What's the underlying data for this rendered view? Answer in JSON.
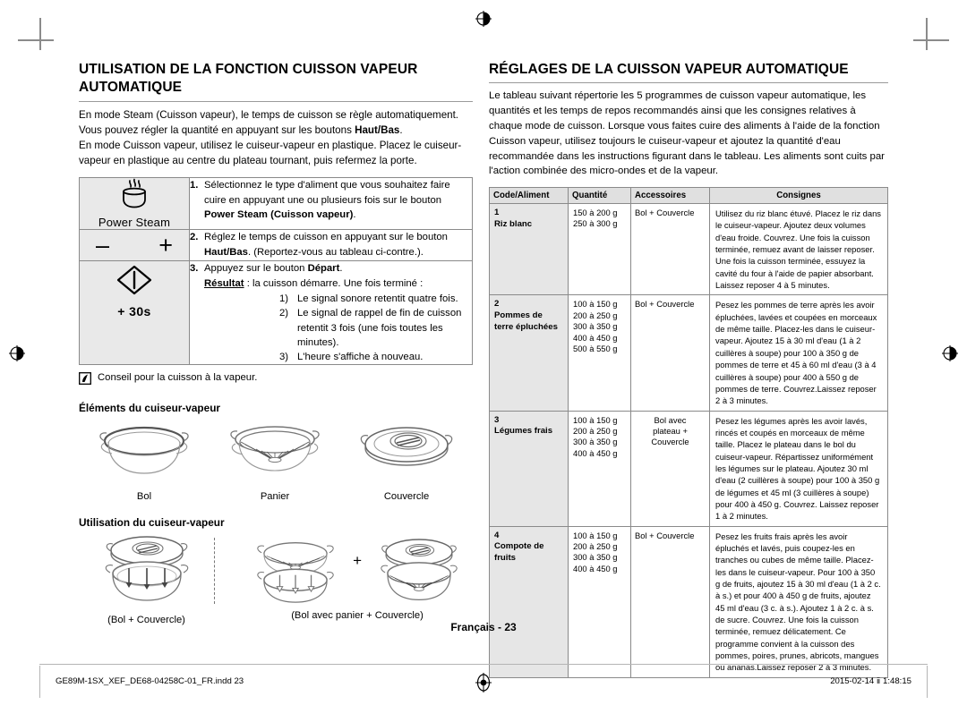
{
  "left": {
    "title": "UTILISATION DE LA FONCTION CUISSON VAPEUR AUTOMATIQUE",
    "intro_1": "En mode Steam (Cuisson vapeur), le temps de cuisson se règle automatiquement.",
    "intro_2a": "Vous pouvez régler la quantité en appuyant sur les boutons ",
    "intro_2b": "Haut/Bas",
    "intro_2c": ".",
    "intro_3": "En mode Cuisson vapeur, utilisez le cuiseur-vapeur en plastique. Placez le cuiseur-vapeur en plastique au centre du plateau tournant, puis refermez la porte.",
    "steps": [
      {
        "num": "1.",
        "icon_name": "power-steam-icon",
        "icon_label": "Power Steam",
        "text_before": "Sélectionnez le type d'aliment que vous souhaitez faire cuire en appuyant une ou plusieurs fois sur le bouton ",
        "text_bold": "Power Steam (Cuisson vapeur)",
        "text_after": "."
      },
      {
        "num": "2.",
        "icon_name": "minus-plus-icon",
        "icon_minus": "–",
        "icon_plus": "+",
        "text_before": "Réglez le temps de cuisson en appuyant sur le bouton ",
        "text_bold": "Haut/Bas",
        "text_after": ". (Reportez-vous au tableau ci-contre.)."
      },
      {
        "num": "3.",
        "icon_name": "start-plus-30s-icon",
        "icon_label": "+ 30s",
        "line1_before": "Appuyez sur le bouton ",
        "line1_bold": "Départ",
        "line1_after": ".",
        "result_label": "Résultat",
        "result_text": " :  la cuisson démarre. Une fois terminé :",
        "sub": [
          {
            "n": "1)",
            "t": "Le signal sonore retentit quatre fois."
          },
          {
            "n": "2)",
            "t": "Le signal de rappel de fin de cuisson retentit 3 fois (une fois toutes les minutes)."
          },
          {
            "n": "3)",
            "t": "L'heure s'affiche à nouveau."
          }
        ]
      }
    ],
    "note": "Conseil pour la cuisson à la vapeur.",
    "subhead_elements": "Éléments du cuiseur-vapeur",
    "elements": [
      {
        "name": "bowl-illustration",
        "caption": "Bol"
      },
      {
        "name": "basket-illustration",
        "caption": "Panier"
      },
      {
        "name": "lid-illustration",
        "caption": "Couvercle"
      }
    ],
    "subhead_usage": "Utilisation du cuiseur-vapeur",
    "usage": [
      {
        "name": "bowl-plus-lid-illustration",
        "caption": "(Bol + Couvercle)"
      },
      {
        "name": "bowl-with-basket-plus-lid-illustration",
        "caption": "(Bol avec panier + Couvercle)"
      }
    ],
    "plus_separator": "+"
  },
  "right": {
    "title": "RÉGLAGES DE LA CUISSON VAPEUR AUTOMATIQUE",
    "intro": "Le tableau suivant répertorie les 5 programmes de cuisson vapeur automatique, les quantités et les temps de repos recommandés ainsi que les consignes relatives à chaque mode de cuisson. Lorsque vous faites cuire des aliments à l'aide de la fonction Cuisson vapeur, utilisez toujours le cuiseur-vapeur et ajoutez la quantité d'eau recommandée dans les instructions figurant dans le tableau. Les aliments sont cuits par l'action combinée des micro-ondes et de la vapeur.",
    "table": {
      "headers": [
        "Code/Aliment",
        "Quantité",
        "Accessoires",
        "Consignes"
      ],
      "rows": [
        {
          "code": "1",
          "food": "Riz blanc",
          "quantities": [
            "150 à 200 g",
            "250 à 300 g"
          ],
          "accessories": [
            "Bol + Couvercle"
          ],
          "accessories_center": false,
          "instructions": "Utilisez du riz blanc étuvé. Placez le riz dans le cuiseur-vapeur. Ajoutez deux volumes d'eau froide. Couvrez. Une fois la cuisson terminée, remuez avant de laisser reposer. Une fois la cuisson terminée, essuyez la cavité du four à l'aide de papier absorbant. Laissez reposer 4 à 5 minutes."
        },
        {
          "code": "2",
          "food": "Pommes de terre épluchées",
          "quantities": [
            "100 à 150 g",
            "200 à 250 g",
            "300 à 350 g",
            "400 à 450 g",
            "500 à 550 g"
          ],
          "accessories": [
            "Bol + Couvercle"
          ],
          "accessories_center": false,
          "instructions": "Pesez les pommes de terre après les avoir épluchées, lavées et coupées en morceaux de même taille. Placez-les dans le cuiseur-vapeur. Ajoutez 15 à 30 ml d'eau (1 à 2 cuillères à soupe) pour 100 à 350 g de pommes de terre et 45 à 60 ml d'eau (3 à 4 cuillères à soupe) pour 400 à 550 g de pommes de terre. Couvrez.Laissez reposer 2 à 3 minutes."
        },
        {
          "code": "3",
          "food": "Légumes frais",
          "quantities": [
            "100 à 150 g",
            "200 à 250 g",
            "300 à 350 g",
            "400 à 450 g"
          ],
          "accessories": [
            "Bol avec",
            "plateau +",
            "Couvercle"
          ],
          "accessories_center": true,
          "instructions": "Pesez les légumes après les avoir lavés, rincés et coupés en morceaux de même taille. Placez le plateau dans le bol du cuiseur-vapeur. Répartissez uniformément les légumes sur le plateau. Ajoutez 30 ml d'eau (2 cuillères à soupe) pour 100 à 350 g de légumes et 45 ml (3 cuillères à soupe) pour 400 à 450 g. Couvrez. Laissez reposer 1 à 2 minutes."
        },
        {
          "code": "4",
          "food": "Compote de fruits",
          "quantities": [
            "100 à 150 g",
            "200 à 250 g",
            "300 à 350 g",
            "400 à 450 g"
          ],
          "accessories": [
            "Bol + Couvercle"
          ],
          "accessories_center": false,
          "instructions": "Pesez les fruits frais après les avoir épluchés et lavés, puis coupez-les en tranches ou cubes de même taille. Placez-les dans le cuiseur-vapeur. Pour 100 à 350 g de fruits, ajoutez 15 à 30 ml d'eau (1 à 2 c. à s.) et pour 400 à 450 g de fruits, ajoutez 45 ml d'eau (3 c. à s.). Ajoutez 1 à 2 c. à s. de sucre. Couvrez. Une fois la cuisson terminée, remuez délicatement. Ce programme convient à la cuisson des pommes, poires, prunes, abricots, mangues ou ananas.Laissez reposer 2 à 3 minutes."
        }
      ]
    }
  },
  "footer": {
    "page_label": "Français -  23",
    "file_name": "GE89M-1SX_XEF_DE68-04258C-01_FR.indd   23",
    "timestamp": "2015-02-14   ⅱ 1:48:15"
  }
}
